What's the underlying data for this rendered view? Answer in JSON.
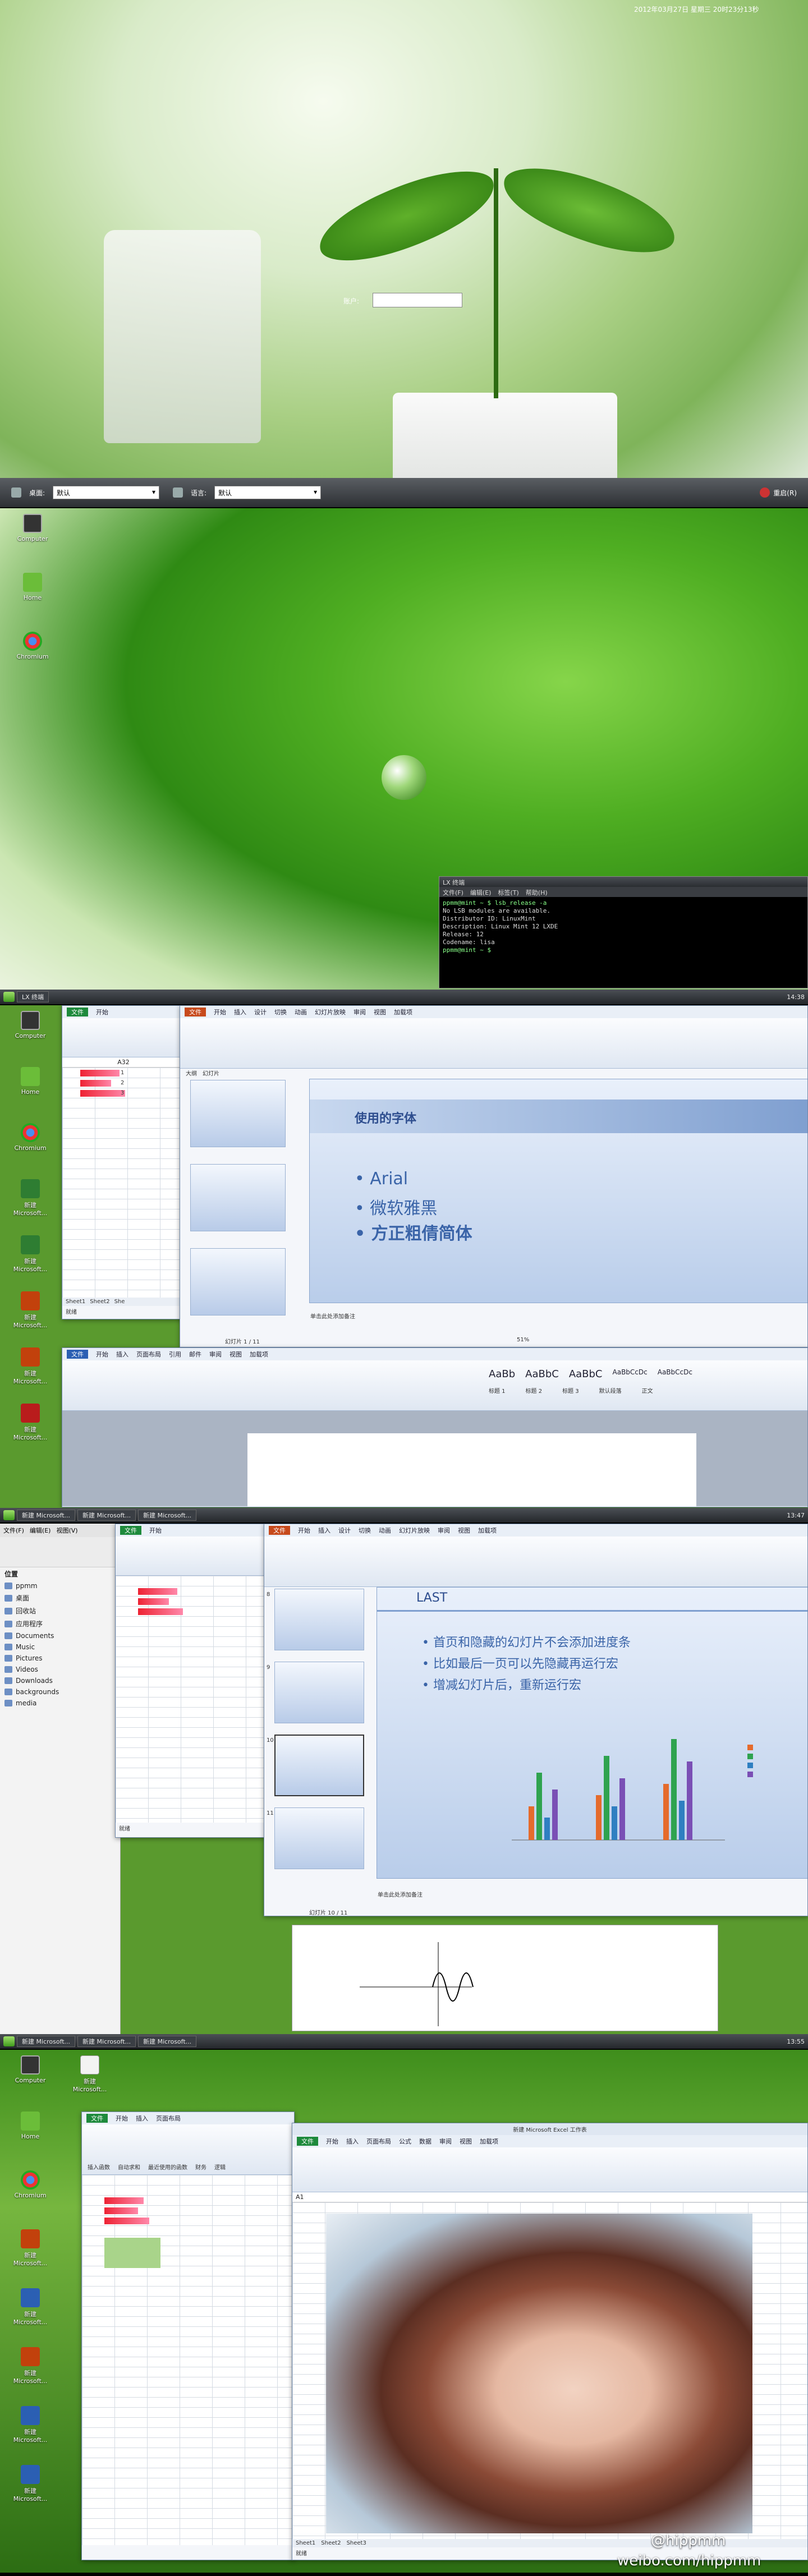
{
  "login": {
    "datetime": "2012年03月27日 星期三 20时23分13秒",
    "user_label": "账户:",
    "desktop_label": "桌面:",
    "desktop_value": "默认",
    "language_label": "语言:",
    "language_value": "默认",
    "restart_label": "重启(R)"
  },
  "desktop": {
    "icons": [
      "Computer",
      "Home",
      "Chromium"
    ],
    "icons_ms": [
      "新建 Microsoft...",
      "新建 Microsoft...",
      "新建 Microsoft...",
      "新建 Microsoft...",
      "新建 Microsoft...",
      "新建 Microsoft..."
    ]
  },
  "terminal": {
    "title": "LX 终端",
    "menu": [
      "文件(F)",
      "编辑(E)",
      "标签(T)",
      "帮助(H)"
    ],
    "lines": [
      "ppmm@mint ~ $ lsb_release -a",
      "No LSB modules are available.",
      "Distributor ID: LinuxMint",
      "Description:     Linux Mint 12 LXDE",
      "Release:        12",
      "Codename:       lisa",
      "ppmm@mint ~ $"
    ]
  },
  "taskbar2": {
    "item": "LX 终端",
    "clock": "14:38"
  },
  "ppt1": {
    "tabs": [
      "文件",
      "开始",
      "插入",
      "设计",
      "切换",
      "动画",
      "幻灯片放映",
      "审阅",
      "视图",
      "加载项"
    ],
    "panel_tabs": [
      "大纲",
      "幻灯片"
    ],
    "slide_title": "使用的字体",
    "bullets": [
      "Arial",
      "微软雅黑",
      "方正粗倩简体"
    ],
    "notes": "单击此处添加备注",
    "status": "幻灯片 1 / 11",
    "zoom": "51%"
  },
  "excel_small": {
    "tabs": [
      "文件",
      "开始"
    ],
    "cell_ref": "A32",
    "sheets": [
      "Sheet1",
      "Sheet2",
      "She"
    ],
    "status": "就绪",
    "values": [
      "1",
      "2",
      "3"
    ]
  },
  "word1": {
    "tabs": [
      "文件",
      "开始",
      "插入",
      "页面布局",
      "引用",
      "邮件",
      "审阅",
      "视图",
      "加载项"
    ],
    "styles": [
      "AaBb",
      "AaBbC",
      "AaBbC",
      "AaBbCcDc",
      "AaBbCcDc"
    ],
    "style_names": [
      "标题 1",
      "标题 2",
      "标题 3",
      "默认段落",
      "正文"
    ]
  },
  "taskbar3": {
    "items": [
      "新建 Microsoft...",
      "新建 Microsoft...",
      "新建 Microsoft..."
    ],
    "clock": "13:47"
  },
  "filemgr": {
    "menu": [
      "文件(F)",
      "编辑(E)",
      "视图(V)"
    ],
    "places": [
      "位置",
      "ppmm",
      "桌面",
      "回收站",
      "应用程序",
      "Documents",
      "Music",
      "Pictures",
      "Videos",
      "Downloads",
      "backgrounds",
      "media"
    ]
  },
  "ppt2": {
    "slide_title": "LAST",
    "bullets": [
      "首页和隐藏的幻灯片不会添加进度条",
      "比如最后一页可以先隐藏再运行宏",
      "增减幻灯片后，重新运行宏"
    ],
    "status": "幻灯片 10 / 11",
    "notes": "单击此处添加备注",
    "thumb_numbers": [
      "8",
      "9",
      "10",
      "11"
    ]
  },
  "taskbar4": {
    "items": [
      "新建 Microsoft...",
      "新建 Microsoft...",
      "新建 Microsoft..."
    ],
    "clock": "13:55"
  },
  "excel_big": {
    "title": "新建 Microsoft Excel 工作表",
    "tabs": [
      "文件",
      "开始",
      "插入",
      "页面布局",
      "公式",
      "数据",
      "审阅",
      "视图",
      "加载项"
    ],
    "toolbar": [
      "插入函数",
      "自动求和",
      "最近使用的函数",
      "财务",
      "逻辑",
      "文本",
      "日期和时间"
    ],
    "cell_ref": "A1",
    "sheets": [
      "Sheet1",
      "Sheet2",
      "Sheet3"
    ],
    "status": "就绪"
  },
  "watermark": "weibo.com/hippmm",
  "watermark2": "@hippmm"
}
